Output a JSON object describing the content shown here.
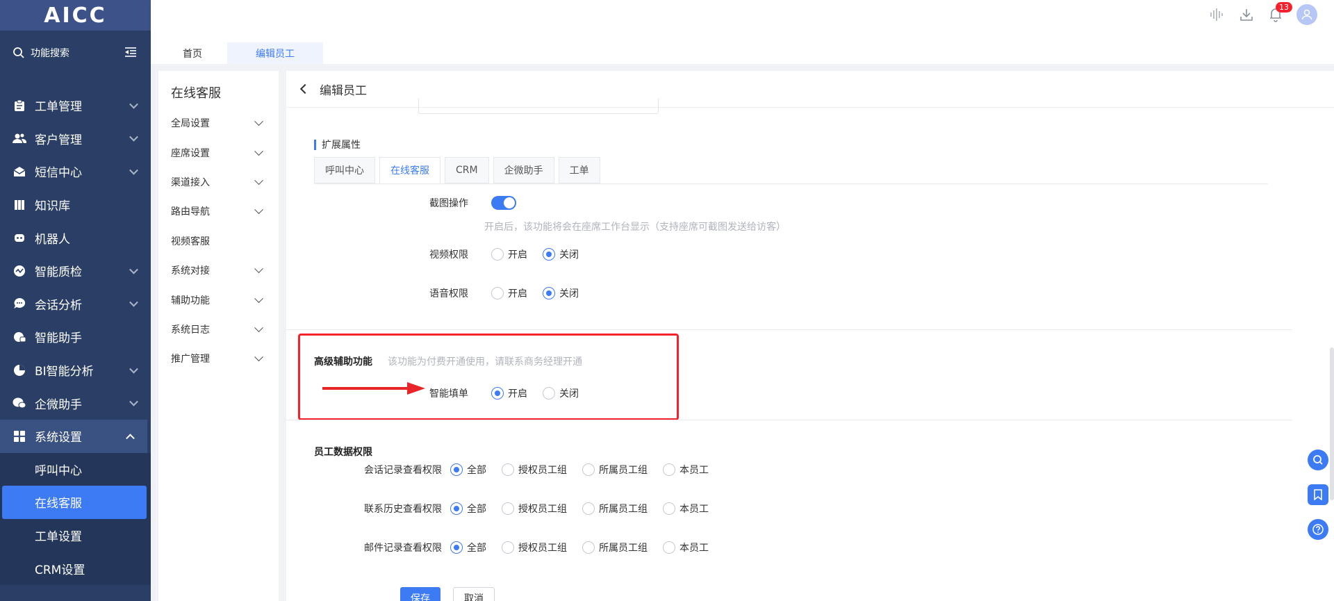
{
  "app": {
    "logo": "AICC",
    "search_label": "功能搜索",
    "notification_count": "13"
  },
  "sidebar": {
    "items": [
      {
        "label": "工单管理",
        "icon": "clipboard-icon",
        "arrow": true
      },
      {
        "label": "客户管理",
        "icon": "users-icon",
        "arrow": true
      },
      {
        "label": "短信中心",
        "icon": "mail-icon",
        "arrow": true
      },
      {
        "label": "知识库",
        "icon": "book-icon",
        "arrow": false
      },
      {
        "label": "机器人",
        "icon": "robot-icon",
        "arrow": false
      },
      {
        "label": "智能质检",
        "icon": "inspect-icon",
        "arrow": true
      },
      {
        "label": "会话分析",
        "icon": "chat-icon",
        "arrow": true
      },
      {
        "label": "智能助手",
        "icon": "assistant-icon",
        "arrow": false
      },
      {
        "label": "BI智能分析",
        "icon": "pie-icon",
        "arrow": true
      },
      {
        "label": "企微助手",
        "icon": "wecom-icon",
        "arrow": true
      },
      {
        "label": "系统设置",
        "icon": "grid-icon",
        "arrow": true
      }
    ],
    "subitems": [
      "呼叫中心",
      "在线客服",
      "工单设置",
      "CRM设置"
    ]
  },
  "tabs": {
    "home": "首页",
    "current": "编辑员工"
  },
  "left_panel": {
    "title": "在线客服",
    "items": [
      {
        "label": "全局设置",
        "chev": true
      },
      {
        "label": "座席设置",
        "chev": true
      },
      {
        "label": "渠道接入",
        "chev": true
      },
      {
        "label": "路由导航",
        "chev": true
      },
      {
        "label": "视频客服",
        "chev": false
      },
      {
        "label": "系统对接",
        "chev": true
      },
      {
        "label": "辅助功能",
        "chev": true
      },
      {
        "label": "系统日志",
        "chev": true
      },
      {
        "label": "推广管理",
        "chev": true
      }
    ]
  },
  "main": {
    "header": "编辑员工",
    "ext_title": "扩展属性",
    "ptabs": [
      "呼叫中心",
      "在线客服",
      "CRM",
      "企微助手",
      "工单"
    ],
    "screenshot_label": "截图操作",
    "screenshot_hint": "开启后，该功能将会在座席工作台显示（支持座席可截图发送给访客）",
    "video_label": "视频权限",
    "voice_label": "语音权限",
    "on": "开启",
    "off": "关闭",
    "adv_title": "高级辅助功能",
    "adv_hint": "该功能为付费开通使用，请联系商务经理开通",
    "smart_fill_label": "智能填单",
    "staff_perm_title": "员工数据权限",
    "perm_rows": [
      "会话记录查看权限",
      "联系历史查看权限",
      "邮件记录查看权限"
    ],
    "perm_options": [
      "全部",
      "授权员工组",
      "所属员工组",
      "本员工"
    ],
    "save": "保存",
    "cancel": "取消"
  },
  "colors": {
    "sidebar_bg": "#2b3f66",
    "accent": "#3d7bf5",
    "highlight_box": "#f5222d"
  }
}
